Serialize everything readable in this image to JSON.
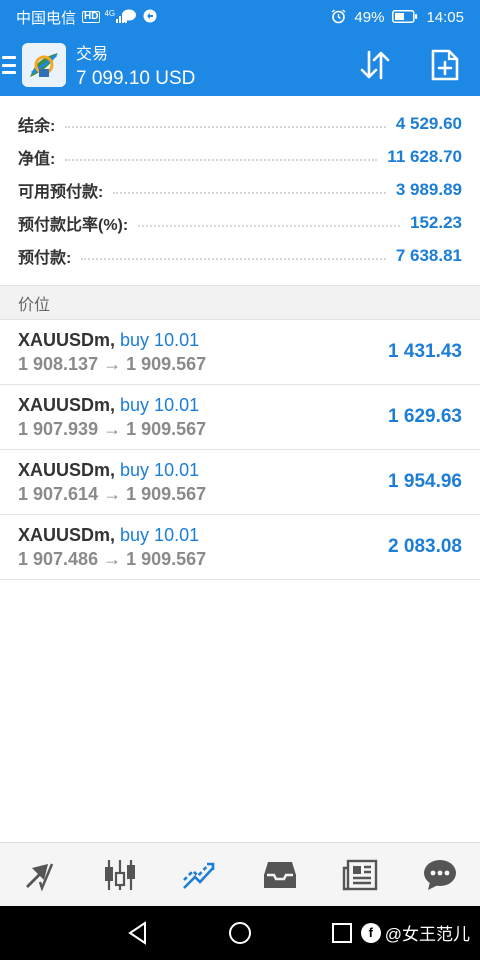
{
  "status_bar": {
    "carrier": "中国电信",
    "network_badge": "HD",
    "signal_text": "4G",
    "battery": "49%",
    "time": "14:05",
    "icons": [
      "hd-icon",
      "signal-icon",
      "chat-icon",
      "vpn-icon",
      "alarm-icon",
      "battery-icon"
    ]
  },
  "app_bar": {
    "title": "交易",
    "balance_line": "7 099.10 USD",
    "actions": [
      "sort-icon",
      "new-order-icon"
    ]
  },
  "summary": {
    "rows": [
      {
        "label": "结余:",
        "value": "4 529.60"
      },
      {
        "label": "净值:",
        "value": "11 628.70"
      },
      {
        "label": "可用预付款:",
        "value": "3 989.89"
      },
      {
        "label": "预付款比率(%):",
        "value": "152.23"
      },
      {
        "label": "预付款:",
        "value": "7 638.81"
      }
    ]
  },
  "section": {
    "title": "价位"
  },
  "positions": [
    {
      "symbol": "XAUUSDm,",
      "side": "buy 10.01",
      "price_line": "1 908.137 → 1 909.567",
      "profit": "1 431.43"
    },
    {
      "symbol": "XAUUSDm,",
      "side": "buy 10.01",
      "price_line": "1 907.939 → 1 909.567",
      "profit": "1 629.63"
    },
    {
      "symbol": "XAUUSDm,",
      "side": "buy 10.01",
      "price_line": "1 907.614 → 1 909.567",
      "profit": "1 954.96"
    },
    {
      "symbol": "XAUUSDm,",
      "side": "buy 10.01",
      "price_line": "1 907.486 → 1 909.567",
      "profit": "2 083.08"
    }
  ],
  "bottom_nav": [
    {
      "icon": "quotes-icon",
      "active": false
    },
    {
      "icon": "chart-icon",
      "active": false
    },
    {
      "icon": "trade-icon",
      "active": true
    },
    {
      "icon": "history-icon",
      "active": false
    },
    {
      "icon": "news-icon",
      "active": false
    },
    {
      "icon": "chat-icon",
      "active": false
    }
  ],
  "watermark": {
    "badge": "f",
    "text": "@女王范儿"
  },
  "colors": {
    "brand": "#1e88e5",
    "value_blue": "#1c7ed6",
    "nav_icon": "#555555",
    "nav_active": "#1c7ed6"
  }
}
